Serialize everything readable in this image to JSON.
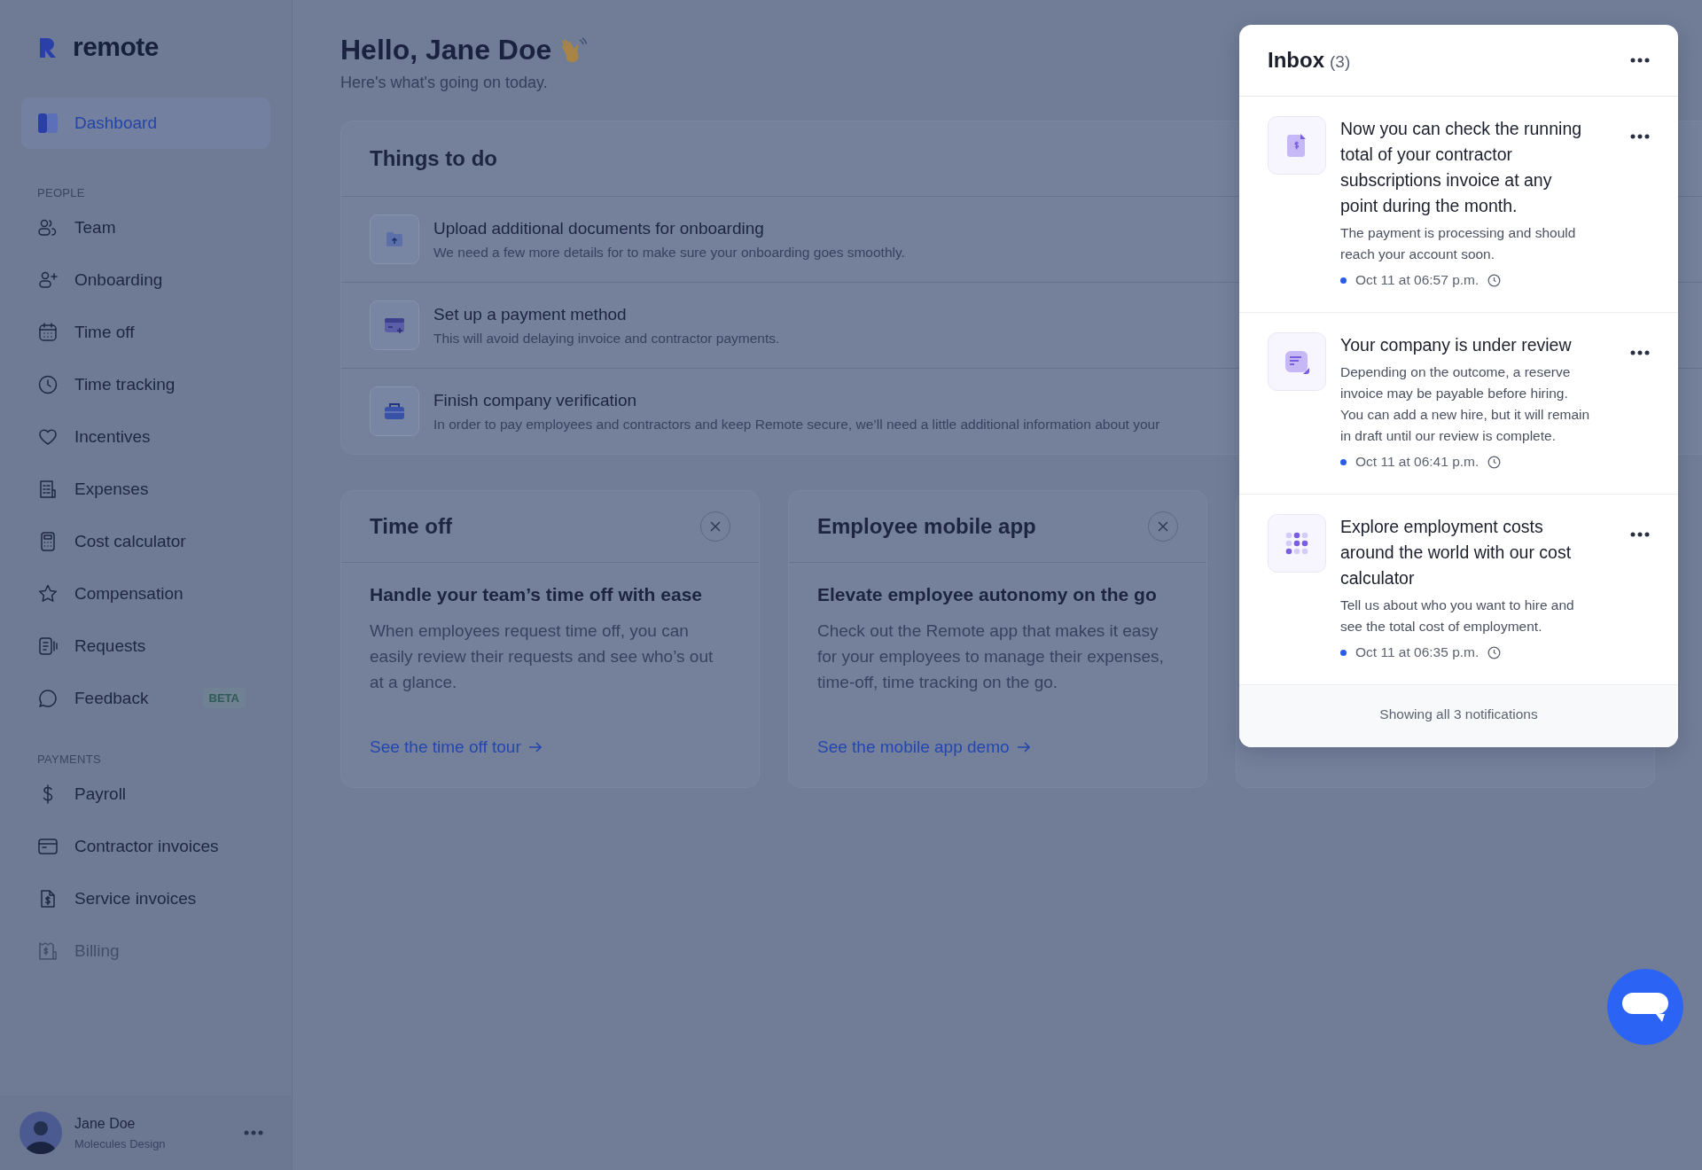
{
  "brand": {
    "name": "remote"
  },
  "nav": {
    "main": [
      {
        "label": "Dashboard",
        "selected": true
      }
    ],
    "sections": [
      {
        "heading": "PEOPLE",
        "items": [
          {
            "label": "Team",
            "selected": false
          },
          {
            "label": "Onboarding",
            "selected": false
          },
          {
            "label": "Time off",
            "selected": false
          },
          {
            "label": "Time tracking",
            "selected": false
          },
          {
            "label": "Incentives",
            "selected": false
          },
          {
            "label": "Expenses",
            "selected": false
          },
          {
            "label": "Cost calculator",
            "selected": false
          },
          {
            "label": "Compensation",
            "selected": false
          },
          {
            "label": "Requests",
            "selected": false
          },
          {
            "label": "Feedback",
            "selected": false,
            "badge": "BETA"
          }
        ]
      },
      {
        "heading": "PAYMENTS",
        "items": [
          {
            "label": "Payroll",
            "selected": false
          },
          {
            "label": "Contractor invoices",
            "selected": false
          },
          {
            "label": "Service invoices",
            "selected": false
          },
          {
            "label": "Billing",
            "selected": false
          }
        ]
      }
    ]
  },
  "user": {
    "name": "Jane Doe",
    "company": "Molecules Design"
  },
  "greeting": {
    "title": "Hello, Jane Doe",
    "subtitle": "Here's what's going on today."
  },
  "todo": {
    "title": "Things to do",
    "items": [
      {
        "title": "Upload additional documents for onboarding",
        "description": "We need a few more details for to make sure your onboarding goes smoothly."
      },
      {
        "title": "Set up a payment method",
        "description": "This will avoid delaying invoice and contractor payments."
      },
      {
        "title": "Finish company verification",
        "description": "In order to pay employees and contractors and keep Remote secure, we’ll need a little additional information about your"
      }
    ]
  },
  "cards": [
    {
      "covered": false,
      "title": "Time off",
      "heading": "Handle your team’s time off with ease",
      "body": "When employees request time off, you can easily review their requests and see who’s out at a glance.",
      "link": "See the time off tour"
    },
    {
      "covered": false,
      "title": "Employee mobile app",
      "heading": "Elevate employee autonomy on the go",
      "body": "Check out the Remote app that makes it easy for your employees to manage their expenses, time-off, time tracking on the go.",
      "link": "See the mobile app demo"
    },
    {
      "covered": true
    }
  ],
  "inbox": {
    "title": "Inbox",
    "count": "(3)",
    "items": [
      {
        "title": "Now you can check the running total of your contractor subscriptions invoice at any point during the month.",
        "body": "The payment is processing and should reach your account soon.",
        "time": "Oct 11 at 06:57 p.m.",
        "unread": true
      },
      {
        "title": "Your company is under review",
        "body": "Depending on the outcome, a reserve invoice may be payable before hiring. You can add a new hire, but it will remain in draft until our review is complete.",
        "time": "Oct 11 at 06:41 p.m.",
        "unread": true
      },
      {
        "title": "Explore employment costs around the world with our cost calculator",
        "body": "Tell us about who you want to hire and see the total cost of employment.",
        "time": "Oct 11 at 06:35 p.m.",
        "unread": true
      }
    ],
    "footer": "Showing all 3 notifications"
  }
}
